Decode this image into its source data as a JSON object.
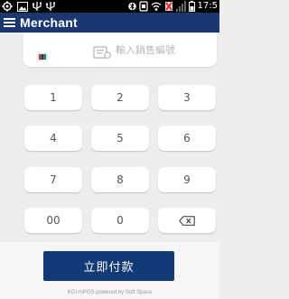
{
  "status_bar": {
    "time": "17:5",
    "icons": [
      "target-icon",
      "image-icon",
      "usb-icon",
      "usb-icon",
      "bluetooth-icon",
      "nfc-icon",
      "wifi-icon",
      "no-sim-icon",
      "signal-icon",
      "battery-icon"
    ]
  },
  "app_bar": {
    "title": "Merchant",
    "menu_icon": "hamburger-menu-icon"
  },
  "card_section": {
    "prompt": "輸入銷售編號"
  },
  "keypad": {
    "keys": [
      "1",
      "2",
      "3",
      "4",
      "5",
      "6",
      "7",
      "8",
      "9",
      "00",
      "0"
    ],
    "backspace_icon": "backspace-icon"
  },
  "action": {
    "pay_label": "立即付款"
  },
  "footer": {
    "text": "KGI mPOS powered by Soft Space"
  },
  "colors": {
    "app_bar": "#1a3772",
    "pay_button": "#113a76",
    "background": "#ededed"
  }
}
